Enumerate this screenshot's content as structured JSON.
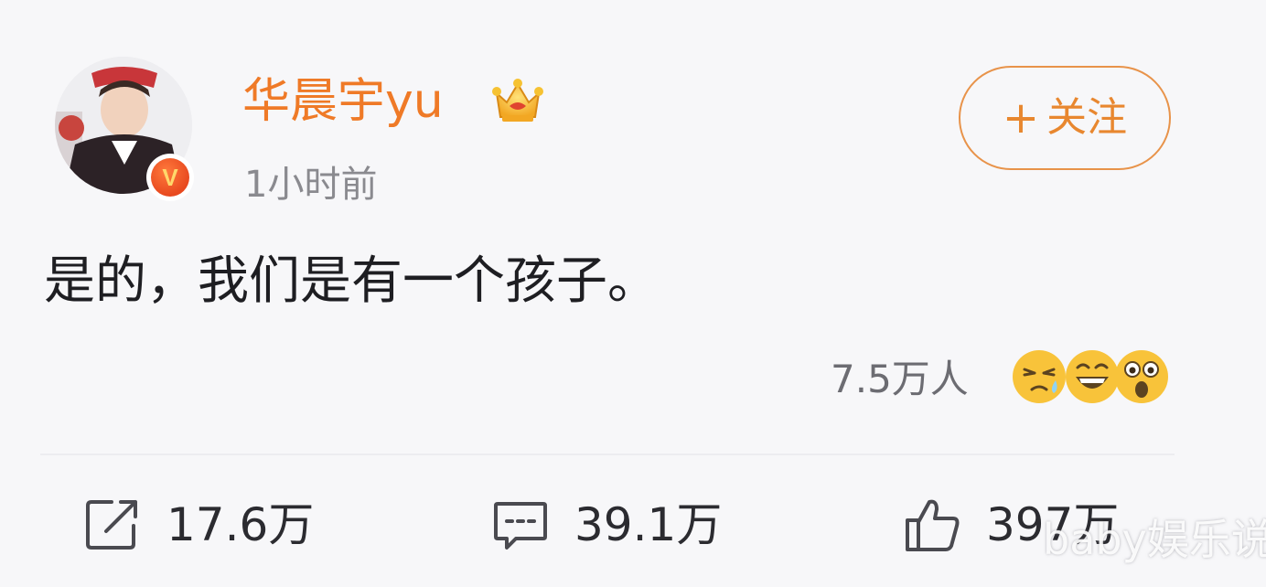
{
  "post": {
    "username": "华晨宇yu",
    "timestamp": "1小时前",
    "follow_plus": "+",
    "follow_label": "关注",
    "text": "是的，我们是有一个孩子。",
    "reaction_count": "7.5万人",
    "reaction_emojis": [
      "sweat-face-emoji",
      "laughing-face-emoji",
      "shocked-face-emoji"
    ],
    "verified_badge": "V"
  },
  "actions": {
    "repost_count": "17.6万",
    "comment_count": "39.1万",
    "like_count": "397万"
  },
  "watermark": "baby娱乐说",
  "colors": {
    "username": "#ef7a27",
    "follow_border": "#e8934a",
    "verified_badge": "#e8491f",
    "text": "#1e1e22",
    "meta": "#8a8a8f"
  },
  "icons": {
    "crown": "crown-icon",
    "repost": "share-icon",
    "comment": "comment-icon",
    "like": "thumbs-up-icon"
  }
}
